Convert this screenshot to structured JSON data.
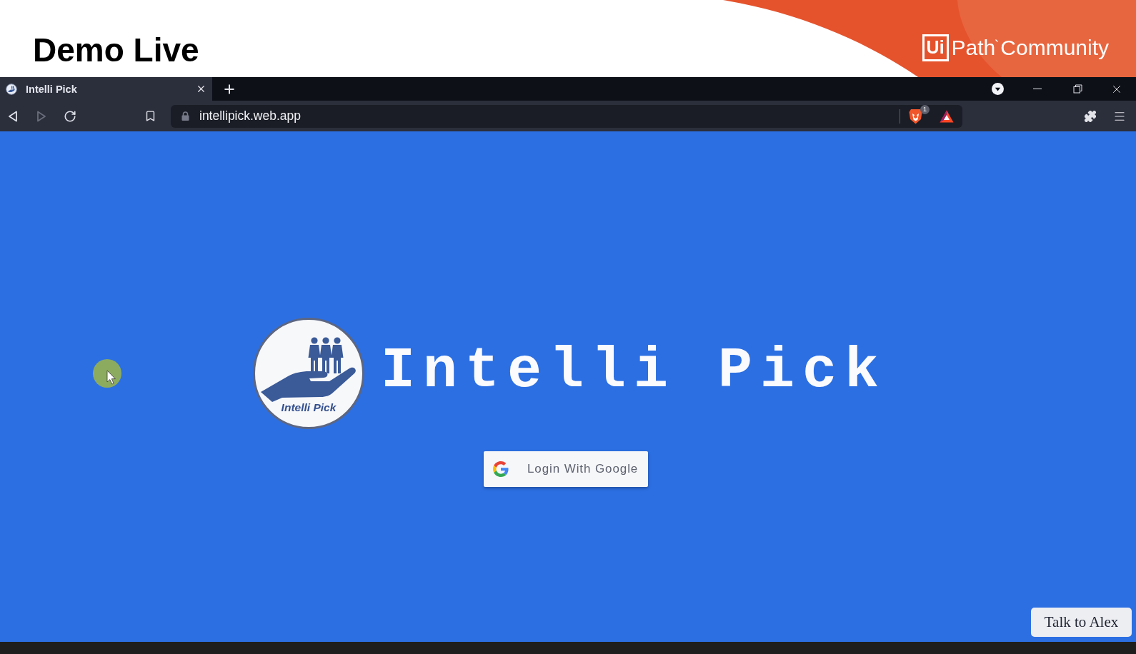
{
  "slide": {
    "title": "Demo Live",
    "brand": {
      "mark": "Ui",
      "name": "Path",
      "tagline": "Community"
    }
  },
  "browser": {
    "tabs": [
      {
        "title": "Intelli Pick",
        "selected": true
      }
    ],
    "toolbar": [
      {
        "kind": "back",
        "disabled": false
      },
      {
        "kind": "forward",
        "disabled": true
      },
      {
        "kind": "reload",
        "disabled": false
      }
    ],
    "address_bar": {
      "url": "intellipick.web.app"
    },
    "shields_count": "1"
  },
  "page": {
    "logo_caption": "Intelli Pick",
    "title": "Intelli Pick",
    "login_button": "Login With Google",
    "chat_button": "Talk to Alex"
  }
}
